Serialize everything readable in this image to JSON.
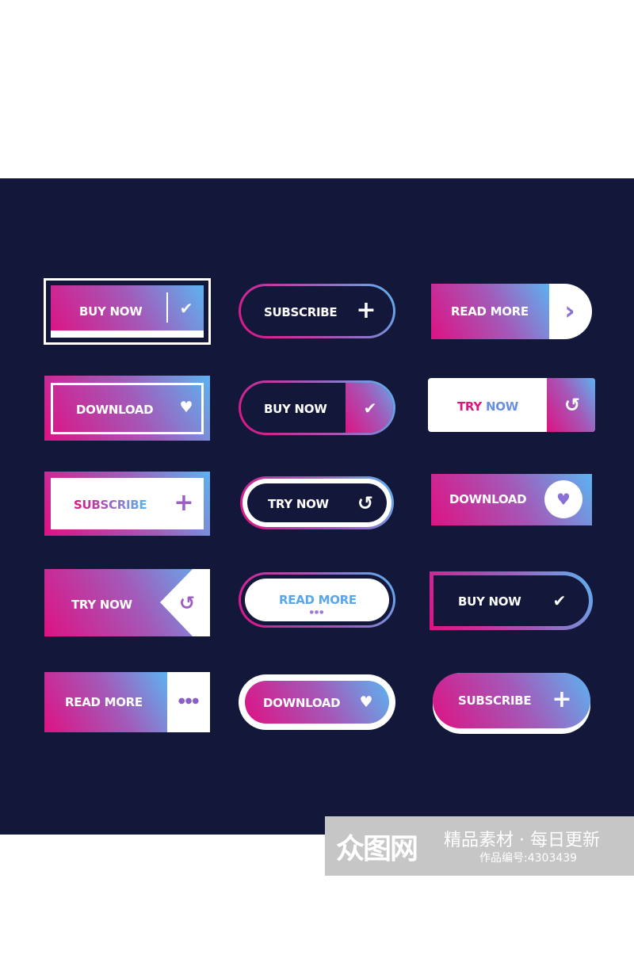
{
  "colors": {
    "background": "#13173a",
    "gradient_start": "#de1283",
    "gradient_mid": "#a35ab9",
    "gradient_end": "#5cb3f1"
  },
  "buttons": [
    {
      "label": "BUY NOW",
      "icon": "check-icon",
      "glyph": "✔"
    },
    {
      "label": "SUBSCRIBE",
      "icon": "plus-icon",
      "glyph": "+"
    },
    {
      "label": "READ MORE",
      "icon": "chevron-right-icon",
      "glyph": "›"
    },
    {
      "label": "DOWNLOAD",
      "icon": "heart-icon",
      "glyph": "♥"
    },
    {
      "label": "BUY NOW",
      "icon": "check-icon",
      "glyph": "✔"
    },
    {
      "label": "TRY",
      "label2": "NOW",
      "icon": "refresh-icon",
      "glyph": "↺"
    },
    {
      "label": "SUBSCRIBE",
      "icon": "plus-icon",
      "glyph": "+"
    },
    {
      "label": "TRY NOW",
      "icon": "refresh-icon",
      "glyph": "↺"
    },
    {
      "label": "DOWNLOAD",
      "icon": "heart-icon",
      "glyph": "♥"
    },
    {
      "label": "TRY NOW",
      "icon": "refresh-icon",
      "glyph": "↺"
    },
    {
      "label": "READ MORE",
      "icon": "dots-icon",
      "glyph": "●●●"
    },
    {
      "label": "BUY NOW",
      "icon": "check-icon",
      "glyph": "✔"
    },
    {
      "label": "READ MORE",
      "icon": "more-dots-icon",
      "glyph": "●●●"
    },
    {
      "label": "DOWNLOAD",
      "icon": "heart-icon",
      "glyph": "♥"
    },
    {
      "label": "SUBSCRIBE",
      "icon": "plus-icon",
      "glyph": "+"
    }
  ],
  "watermark": {
    "logo": "众图网",
    "slogan": "精品素材 · 每日更新",
    "id_text": "作品编号:4303439"
  }
}
